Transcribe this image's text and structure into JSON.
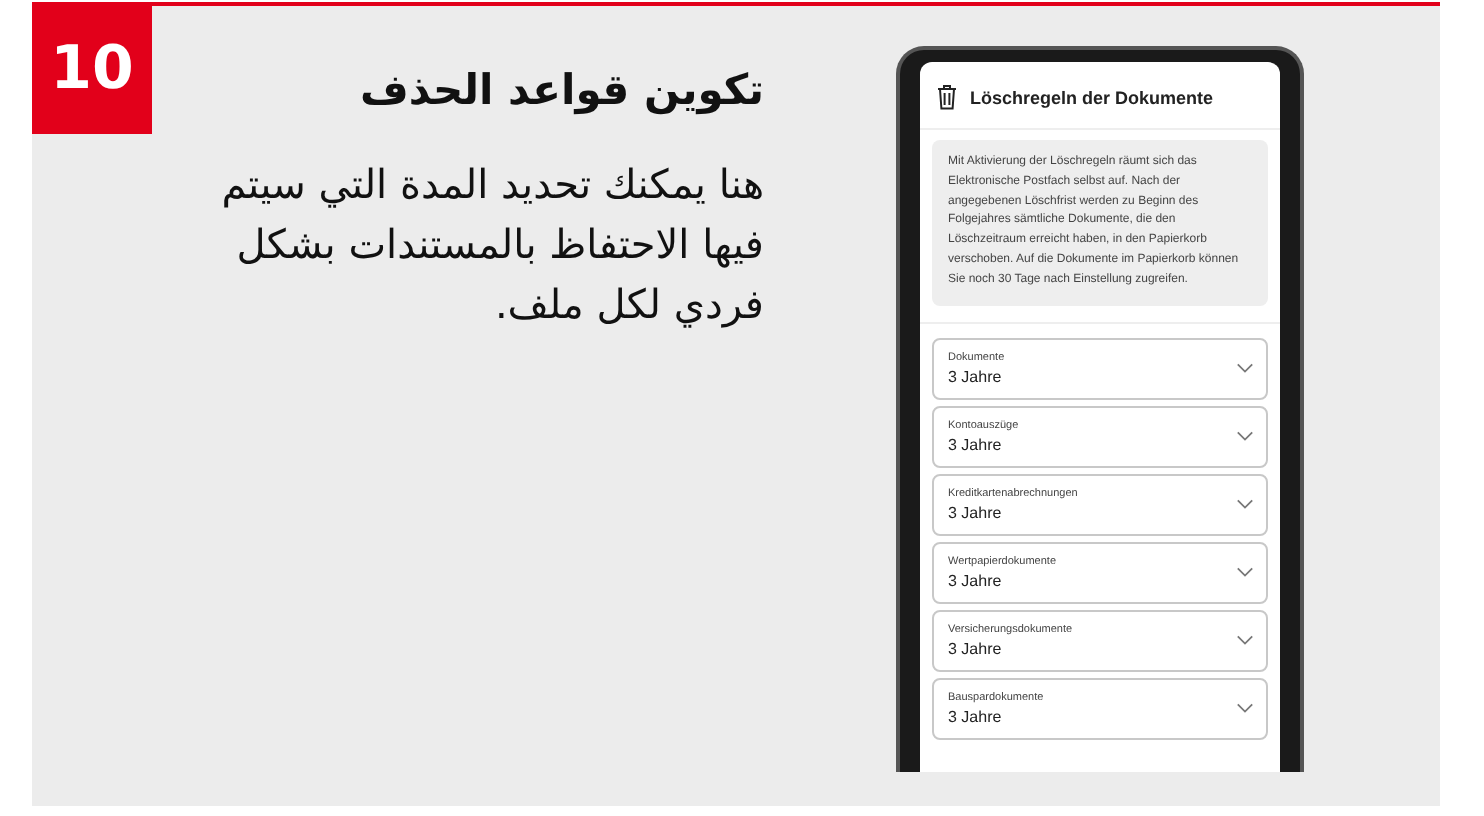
{
  "step": {
    "number": "10",
    "title": "تكوين قواعد الحذف",
    "description": "هنا يمكنك تحديد المدة التي سيتم فيها الاحتفاظ بالمستندات بشكل فردي لكل ملف."
  },
  "phone": {
    "screen_title": "Löschregeln der Dokumente",
    "info_text": "Mit Aktivierung der Löschregeln räumt sich das Elektronische Postfach selbst auf. Nach der angegebenen Löschfrist werden zu Beginn des Folgejahres sämtliche Dokumente, die den Löschzeitraum erreicht haben, in den Papierkorb verschoben. Auf die Dokumente im Papierkorb können Sie noch 30 Tage nach Einstellung zugreifen.",
    "fields": [
      {
        "label": "Dokumente",
        "value": "3 Jahre"
      },
      {
        "label": "Kontoauszüge",
        "value": "3 Jahre"
      },
      {
        "label": "Kreditkartenabrechnungen",
        "value": "3 Jahre"
      },
      {
        "label": "Wertpapierdokumente",
        "value": "3 Jahre"
      },
      {
        "label": "Versicherungsdokumente",
        "value": "3 Jahre"
      },
      {
        "label": "Bauspardokumente",
        "value": "3 Jahre"
      }
    ]
  }
}
